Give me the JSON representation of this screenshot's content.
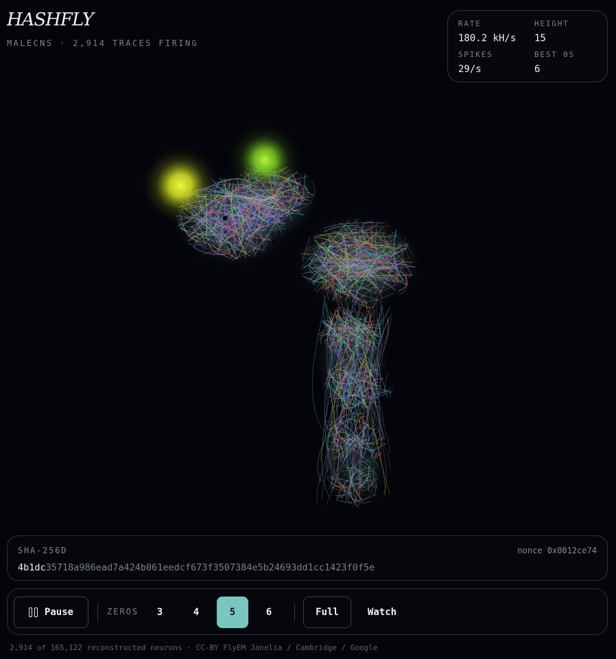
{
  "brand": {
    "title": "HASHFLY",
    "subtitle": "MALECNS · 2,914 TRACES FIRING"
  },
  "stats": [
    {
      "label": "RATE",
      "value": "180.2 kH/s"
    },
    {
      "label": "HEIGHT",
      "value": "15"
    },
    {
      "label": "SPIKES",
      "value": "29/s"
    },
    {
      "label": "BEST 0S",
      "value": "6"
    }
  ],
  "hash": {
    "label": "SHA-256D",
    "nonce": "nonce 0x0012ce74",
    "prefix": "4b1dc",
    "rest": "35718a986ead7a424b061eedcf673f3507384e5b24693dd1cc1423f0f5e"
  },
  "controls": {
    "pause_label": "Pause",
    "zeros_label": "ZEROS",
    "zero_options": [
      "3",
      "4",
      "5",
      "6"
    ],
    "selected_zero": "5",
    "full_label": "Full",
    "watch_label": "Watch"
  },
  "footer": "2,914 of 165,122 reconstructed neurons · CC-BY FlyEM Janelia / Cambridge / Google",
  "colors": {
    "background": "#04050a",
    "accent": "#7cc4c0",
    "glow_yellow": "#e8f03a",
    "glow_green": "#8fe63a"
  }
}
